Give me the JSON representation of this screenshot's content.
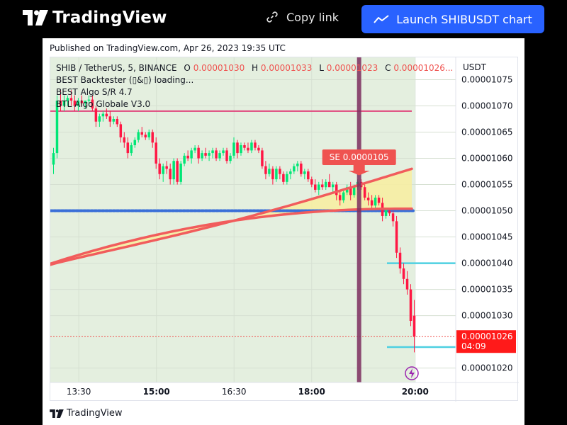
{
  "header": {
    "brand": "TradingView",
    "copy_link_label": "Copy link",
    "launch_label": "Launch SHIBUSDT chart"
  },
  "published": "Published on TradingView.com, Apr 26, 2023 19:35 UTC",
  "footer_brand": "TradingView",
  "chart_data": {
    "type": "candlestick",
    "symbol_line": {
      "title": "SHIB / TetherUS, 5, BINANCE",
      "o_label": "O",
      "o_value": "0.00001030",
      "h_label": "H",
      "h_value": "0.00001033",
      "l_label": "L",
      "l_value": "0.00001023",
      "c_label": "C",
      "c_value": "0.00001026..."
    },
    "indicators": [
      "BEST Backtester (▯&▯) loading...",
      "BEST Algo S/R 4.7",
      "BTL Algo Globale V3.0"
    ],
    "currency": "USDT",
    "y_ticks": [
      "0.00001075",
      "0.00001070",
      "0.00001065",
      "0.00001060",
      "0.00001055",
      "0.00001050",
      "0.00001045",
      "0.00001040",
      "0.00001035",
      "0.00001030",
      "0.00001020"
    ],
    "ylim": [
      1.01725e-05,
      1.07925e-05
    ],
    "x_ticks": [
      {
        "label": "13:30",
        "bold": false
      },
      {
        "label": "15:00",
        "bold": true
      },
      {
        "label": "16:30",
        "bold": false
      },
      {
        "label": "18:00",
        "bold": true
      },
      {
        "label": "20:00",
        "bold": true
      }
    ],
    "time_range": [
      "12:57",
      "20:47"
    ],
    "last_price": "0.00001026",
    "countdown": "04:09",
    "signal": {
      "label": "SE 0.0000105",
      "time": "18:55",
      "price": 1.05e-05
    },
    "resistance": 1.069e-05,
    "support_dotted": 1.05e-05,
    "tp_levels": [
      {
        "price": 1.04e-05
      },
      {
        "price": 1.024e-05
      }
    ],
    "last_price_value": 1.026e-05,
    "colors": {
      "up": "#00e676",
      "down": "#ff1744",
      "accent": "#2962ff",
      "signal": "#ef5350",
      "vline": "#7b2d5e",
      "tp": "#4dd0e1",
      "support": "#3a6fd8",
      "resistance": "#e0457b"
    },
    "candles": [
      {
        "o": 1058.8,
        "h": 1062,
        "l": 1057,
        "c": 1061
      },
      {
        "o": 1061,
        "h": 1072,
        "l": 1060,
        "c": 1071
      },
      {
        "o": 1071,
        "h": 1073,
        "l": 1069,
        "c": 1070
      },
      {
        "o": 1070,
        "h": 1072,
        "l": 1069,
        "c": 1071
      },
      {
        "o": 1071,
        "h": 1072,
        "l": 1070,
        "c": 1071.5
      },
      {
        "o": 1071.5,
        "h": 1073,
        "l": 1070,
        "c": 1071
      },
      {
        "o": 1071,
        "h": 1072,
        "l": 1069,
        "c": 1070
      },
      {
        "o": 1070,
        "h": 1071.5,
        "l": 1069,
        "c": 1071
      },
      {
        "o": 1071,
        "h": 1072,
        "l": 1070,
        "c": 1070.5
      },
      {
        "o": 1070.5,
        "h": 1071,
        "l": 1069.5,
        "c": 1071
      },
      {
        "o": 1071,
        "h": 1072,
        "l": 1070,
        "c": 1071.2
      },
      {
        "o": 1071.2,
        "h": 1072,
        "l": 1069,
        "c": 1069.5
      },
      {
        "o": 1069.5,
        "h": 1070,
        "l": 1066,
        "c": 1067
      },
      {
        "o": 1067,
        "h": 1068.5,
        "l": 1066,
        "c": 1068
      },
      {
        "o": 1068,
        "h": 1069,
        "l": 1067,
        "c": 1068.5
      },
      {
        "o": 1068.5,
        "h": 1069.5,
        "l": 1067.5,
        "c": 1068
      },
      {
        "o": 1068,
        "h": 1069,
        "l": 1066,
        "c": 1067
      },
      {
        "o": 1067,
        "h": 1068,
        "l": 1066.5,
        "c": 1067.5
      },
      {
        "o": 1067.5,
        "h": 1068,
        "l": 1066,
        "c": 1066.5
      },
      {
        "o": 1066.5,
        "h": 1067,
        "l": 1063,
        "c": 1064
      },
      {
        "o": 1064,
        "h": 1065,
        "l": 1062,
        "c": 1063
      },
      {
        "o": 1063,
        "h": 1064,
        "l": 1060,
        "c": 1061
      },
      {
        "o": 1061,
        "h": 1063,
        "l": 1060.5,
        "c": 1062.5
      },
      {
        "o": 1062.5,
        "h": 1064,
        "l": 1062,
        "c": 1063.5
      },
      {
        "o": 1063.5,
        "h": 1065.5,
        "l": 1063,
        "c": 1065
      },
      {
        "o": 1065,
        "h": 1066,
        "l": 1064,
        "c": 1064.5
      },
      {
        "o": 1064.5,
        "h": 1065,
        "l": 1063.5,
        "c": 1064
      },
      {
        "o": 1064,
        "h": 1065.5,
        "l": 1063.5,
        "c": 1065
      },
      {
        "o": 1065,
        "h": 1065.5,
        "l": 1062,
        "c": 1063
      },
      {
        "o": 1063,
        "h": 1064,
        "l": 1058,
        "c": 1059
      },
      {
        "o": 1059,
        "h": 1060,
        "l": 1056,
        "c": 1057
      },
      {
        "o": 1057,
        "h": 1059,
        "l": 1055.5,
        "c": 1058.5
      },
      {
        "o": 1058.5,
        "h": 1059.5,
        "l": 1057,
        "c": 1058
      },
      {
        "o": 1058,
        "h": 1059,
        "l": 1055,
        "c": 1056
      },
      {
        "o": 1056,
        "h": 1060,
        "l": 1055,
        "c": 1059.5
      },
      {
        "o": 1059.5,
        "h": 1060,
        "l": 1055,
        "c": 1055.5
      },
      {
        "o": 1055.5,
        "h": 1059.5,
        "l": 1055,
        "c": 1059
      },
      {
        "o": 1059,
        "h": 1061,
        "l": 1058.5,
        "c": 1060.5
      },
      {
        "o": 1060.5,
        "h": 1061.5,
        "l": 1059.5,
        "c": 1060
      },
      {
        "o": 1060,
        "h": 1062,
        "l": 1059,
        "c": 1061.5
      },
      {
        "o": 1061.5,
        "h": 1062.5,
        "l": 1061,
        "c": 1062
      },
      {
        "o": 1062,
        "h": 1062.5,
        "l": 1059,
        "c": 1060
      },
      {
        "o": 1060,
        "h": 1061.5,
        "l": 1059.5,
        "c": 1061
      },
      {
        "o": 1061,
        "h": 1062,
        "l": 1060,
        "c": 1060.5
      },
      {
        "o": 1060.5,
        "h": 1061.5,
        "l": 1059.5,
        "c": 1061
      },
      {
        "o": 1061,
        "h": 1062,
        "l": 1060,
        "c": 1061.5
      },
      {
        "o": 1061.5,
        "h": 1062,
        "l": 1059.5,
        "c": 1060
      },
      {
        "o": 1060,
        "h": 1061.5,
        "l": 1059.5,
        "c": 1061
      },
      {
        "o": 1061,
        "h": 1062,
        "l": 1060.5,
        "c": 1061.5
      },
      {
        "o": 1061.5,
        "h": 1062,
        "l": 1059,
        "c": 1059.5
      },
      {
        "o": 1059.5,
        "h": 1061,
        "l": 1059,
        "c": 1060.5
      },
      {
        "o": 1060.5,
        "h": 1064,
        "l": 1060,
        "c": 1063
      },
      {
        "o": 1063,
        "h": 1063.5,
        "l": 1060,
        "c": 1061
      },
      {
        "o": 1061,
        "h": 1063,
        "l": 1060.5,
        "c": 1062.5
      },
      {
        "o": 1062.5,
        "h": 1063,
        "l": 1061.5,
        "c": 1062
      },
      {
        "o": 1062,
        "h": 1063,
        "l": 1061,
        "c": 1061.5
      },
      {
        "o": 1061.5,
        "h": 1063.5,
        "l": 1061,
        "c": 1063
      },
      {
        "o": 1063,
        "h": 1063.5,
        "l": 1061.5,
        "c": 1062
      },
      {
        "o": 1062,
        "h": 1062.5,
        "l": 1061,
        "c": 1061.5
      },
      {
        "o": 1061.5,
        "h": 1062,
        "l": 1058,
        "c": 1058.5
      },
      {
        "o": 1058.5,
        "h": 1059.5,
        "l": 1056,
        "c": 1057
      },
      {
        "o": 1057,
        "h": 1059,
        "l": 1056.5,
        "c": 1058
      },
      {
        "o": 1058,
        "h": 1058.5,
        "l": 1055,
        "c": 1056
      },
      {
        "o": 1056,
        "h": 1058.5,
        "l": 1055.5,
        "c": 1058
      },
      {
        "o": 1058,
        "h": 1058.5,
        "l": 1056,
        "c": 1057
      },
      {
        "o": 1057,
        "h": 1057.5,
        "l": 1055,
        "c": 1055.5
      },
      {
        "o": 1055.5,
        "h": 1057.5,
        "l": 1055,
        "c": 1057
      },
      {
        "o": 1057,
        "h": 1058,
        "l": 1056,
        "c": 1057.5
      },
      {
        "o": 1057.5,
        "h": 1059,
        "l": 1057,
        "c": 1058.5
      },
      {
        "o": 1058.5,
        "h": 1059.5,
        "l": 1057.5,
        "c": 1059
      },
      {
        "o": 1059,
        "h": 1059.5,
        "l": 1056.5,
        "c": 1057
      },
      {
        "o": 1057,
        "h": 1058,
        "l": 1056,
        "c": 1057.5
      },
      {
        "o": 1057.5,
        "h": 1058,
        "l": 1055.5,
        "c": 1056
      },
      {
        "o": 1056,
        "h": 1056.5,
        "l": 1054.5,
        "c": 1055
      },
      {
        "o": 1055,
        "h": 1056,
        "l": 1053.5,
        "c": 1054
      },
      {
        "o": 1054,
        "h": 1055.5,
        "l": 1053,
        "c": 1055
      },
      {
        "o": 1055,
        "h": 1056,
        "l": 1054,
        "c": 1054.5
      },
      {
        "o": 1054.5,
        "h": 1056,
        "l": 1054,
        "c": 1055.5
      },
      {
        "o": 1055.5,
        "h": 1057,
        "l": 1055,
        "c": 1054.5
      },
      {
        "o": 1054.5,
        "h": 1055.5,
        "l": 1053.5,
        "c": 1055
      },
      {
        "o": 1055,
        "h": 1055.5,
        "l": 1052,
        "c": 1053
      },
      {
        "o": 1053,
        "h": 1054,
        "l": 1051,
        "c": 1052
      },
      {
        "o": 1052,
        "h": 1054,
        "l": 1051.5,
        "c": 1053.5
      },
      {
        "o": 1053.5,
        "h": 1055,
        "l": 1053,
        "c": 1054.5
      },
      {
        "o": 1054.5,
        "h": 1055.5,
        "l": 1052,
        "c": 1053
      },
      {
        "o": 1053,
        "h": 1055,
        "l": 1052.5,
        "c": 1054.5
      },
      {
        "o": 1054.5,
        "h": 1056,
        "l": 1054,
        "c": 1055.5
      },
      {
        "o": 1055.5,
        "h": 1056,
        "l": 1054,
        "c": 1054.5
      },
      {
        "o": 1054.5,
        "h": 1055,
        "l": 1052,
        "c": 1052.5
      },
      {
        "o": 1052.5,
        "h": 1053.5,
        "l": 1051,
        "c": 1052
      },
      {
        "o": 1052,
        "h": 1053,
        "l": 1050.5,
        "c": 1051
      },
      {
        "o": 1051,
        "h": 1053,
        "l": 1050.5,
        "c": 1052.5
      },
      {
        "o": 1052.5,
        "h": 1053,
        "l": 1051,
        "c": 1051.5
      },
      {
        "o": 1051.5,
        "h": 1052.5,
        "l": 1048,
        "c": 1049
      },
      {
        "o": 1049,
        "h": 1050.5,
        "l": 1048.5,
        "c": 1050.5
      },
      {
        "o": 1050,
        "h": 1050.5,
        "l": 1049,
        "c": 1049.5
      },
      {
        "o": 1049.5,
        "h": 1050,
        "l": 1047,
        "c": 1048
      },
      {
        "o": 1048,
        "h": 1049,
        "l": 1041,
        "c": 1042
      },
      {
        "o": 1042,
        "h": 1043,
        "l": 1038,
        "c": 1039
      },
      {
        "o": 1039,
        "h": 1040,
        "l": 1036,
        "c": 1037
      },
      {
        "o": 1037,
        "h": 1038.5,
        "l": 1034,
        "c": 1035
      },
      {
        "o": 1035,
        "h": 1036,
        "l": 1028,
        "c": 1029
      },
      {
        "o": 1030,
        "h": 1033,
        "l": 1023,
        "c": 1026
      }
    ]
  }
}
